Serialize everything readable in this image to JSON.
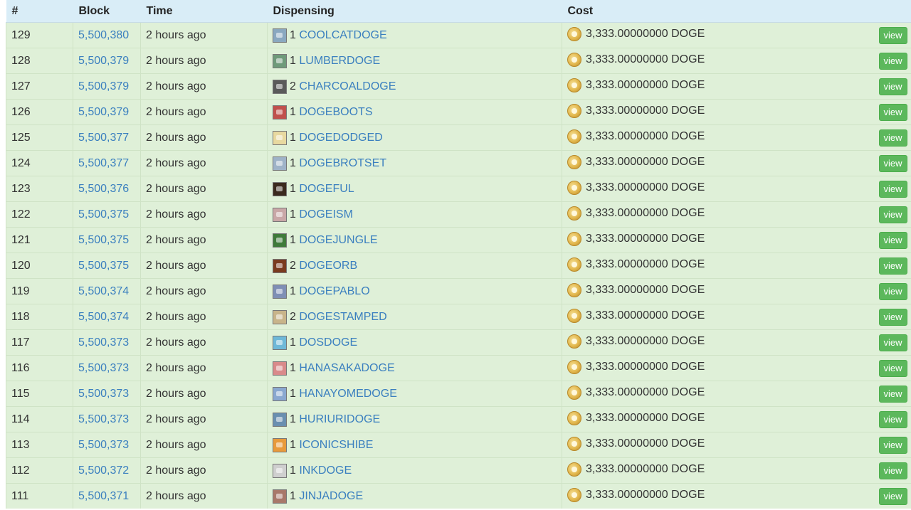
{
  "table": {
    "headers": [
      "#",
      "Block",
      "Time",
      "Dispensing",
      "Cost"
    ],
    "view_label": "view",
    "rows": [
      {
        "id": "129",
        "block": "5,500,380",
        "time": "2 hours ago",
        "qty": "1",
        "asset": "COOLCATDOGE",
        "thumb": "#8aa8c0",
        "cost": "3,333.00000000 DOGE"
      },
      {
        "id": "128",
        "block": "5,500,379",
        "time": "2 hours ago",
        "qty": "1",
        "asset": "LUMBERDOGE",
        "thumb": "#6f9a7a",
        "cost": "3,333.00000000 DOGE"
      },
      {
        "id": "127",
        "block": "5,500,379",
        "time": "2 hours ago",
        "qty": "2",
        "asset": "CHARCOALDOGE",
        "thumb": "#5a5a5a",
        "cost": "3,333.00000000 DOGE"
      },
      {
        "id": "126",
        "block": "5,500,379",
        "time": "2 hours ago",
        "qty": "1",
        "asset": "DOGEBOOTS",
        "thumb": "#c0504d",
        "cost": "3,333.00000000 DOGE"
      },
      {
        "id": "125",
        "block": "5,500,377",
        "time": "2 hours ago",
        "qty": "1",
        "asset": "DOGEDODGED",
        "thumb": "#e8d9a0",
        "cost": "3,333.00000000 DOGE"
      },
      {
        "id": "124",
        "block": "5,500,377",
        "time": "2 hours ago",
        "qty": "1",
        "asset": "DOGEBROTSET",
        "thumb": "#9fb3c8",
        "cost": "3,333.00000000 DOGE"
      },
      {
        "id": "123",
        "block": "5,500,376",
        "time": "2 hours ago",
        "qty": "1",
        "asset": "DOGEFUL",
        "thumb": "#3b2a1e",
        "cost": "3,333.00000000 DOGE"
      },
      {
        "id": "122",
        "block": "5,500,375",
        "time": "2 hours ago",
        "qty": "1",
        "asset": "DOGEISM",
        "thumb": "#c9a7a7",
        "cost": "3,333.00000000 DOGE"
      },
      {
        "id": "121",
        "block": "5,500,375",
        "time": "2 hours ago",
        "qty": "1",
        "asset": "DOGEJUNGLE",
        "thumb": "#3f7a3a",
        "cost": "3,333.00000000 DOGE"
      },
      {
        "id": "120",
        "block": "5,500,375",
        "time": "2 hours ago",
        "qty": "2",
        "asset": "DOGEORB",
        "thumb": "#7a3b1e",
        "cost": "3,333.00000000 DOGE"
      },
      {
        "id": "119",
        "block": "5,500,374",
        "time": "2 hours ago",
        "qty": "1",
        "asset": "DOGEPABLO",
        "thumb": "#7f8fb5",
        "cost": "3,333.00000000 DOGE"
      },
      {
        "id": "118",
        "block": "5,500,374",
        "time": "2 hours ago",
        "qty": "2",
        "asset": "DOGESTAMPED",
        "thumb": "#c8b48a",
        "cost": "3,333.00000000 DOGE"
      },
      {
        "id": "117",
        "block": "5,500,373",
        "time": "2 hours ago",
        "qty": "1",
        "asset": "DOSDOGE",
        "thumb": "#6fb8d8",
        "cost": "3,333.00000000 DOGE"
      },
      {
        "id": "116",
        "block": "5,500,373",
        "time": "2 hours ago",
        "qty": "1",
        "asset": "HANASAKADOGE",
        "thumb": "#d98a8a",
        "cost": "3,333.00000000 DOGE"
      },
      {
        "id": "115",
        "block": "5,500,373",
        "time": "2 hours ago",
        "qty": "1",
        "asset": "HANAYOMEDOGE",
        "thumb": "#8aa8d0",
        "cost": "3,333.00000000 DOGE"
      },
      {
        "id": "114",
        "block": "5,500,373",
        "time": "2 hours ago",
        "qty": "1",
        "asset": "HURIURIDOGE",
        "thumb": "#6a8fb0",
        "cost": "3,333.00000000 DOGE"
      },
      {
        "id": "113",
        "block": "5,500,373",
        "time": "2 hours ago",
        "qty": "1",
        "asset": "ICONICSHIBE",
        "thumb": "#e89a3c",
        "cost": "3,333.00000000 DOGE"
      },
      {
        "id": "112",
        "block": "5,500,372",
        "time": "2 hours ago",
        "qty": "1",
        "asset": "INKDOGE",
        "thumb": "#cfcfcf",
        "cost": "3,333.00000000 DOGE"
      },
      {
        "id": "111",
        "block": "5,500,371",
        "time": "2 hours ago",
        "qty": "1",
        "asset": "JINJADOGE",
        "thumb": "#a8786a",
        "cost": "3,333.00000000 DOGE"
      }
    ]
  }
}
